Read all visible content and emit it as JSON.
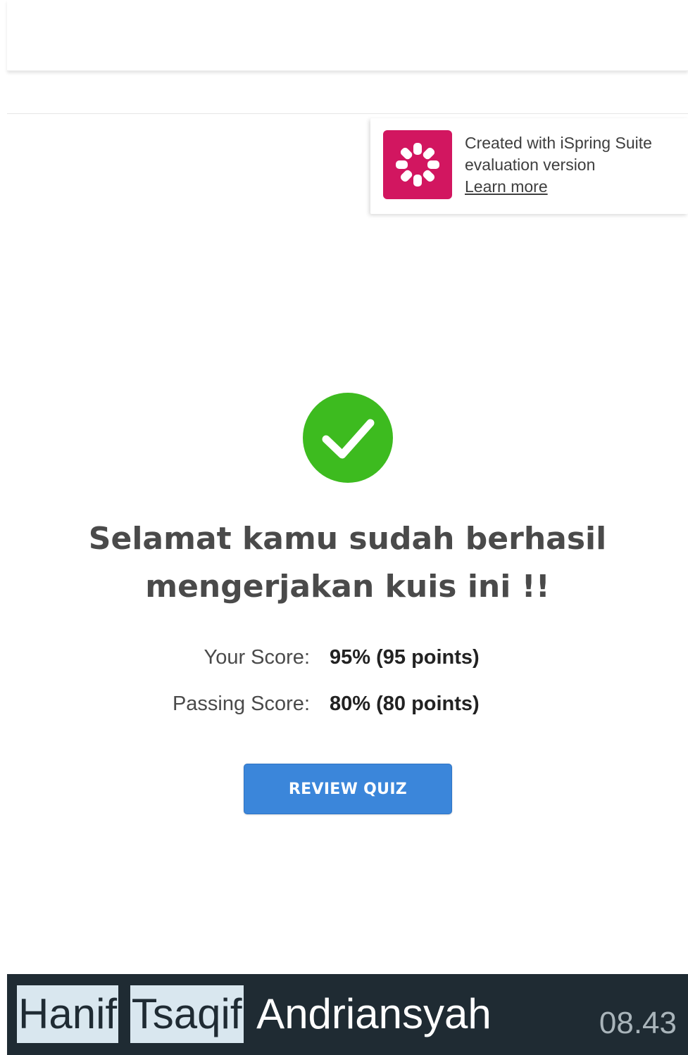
{
  "ispring_banner": {
    "line1": "Created with iSpring Suite",
    "line2": "evaluation version",
    "link": "Learn more",
    "logo_icon": "ispring-logo-icon",
    "logo_color": "#d21660"
  },
  "result": {
    "status_icon": "checkmark-icon",
    "status_color": "#3dbb1f",
    "headline_line1": "Selamat kamu sudah berhasil",
    "headline_line2": "mengerjakan kuis ini !!",
    "your_score_label": "Your Score:",
    "your_score_value": "95% (95 points)",
    "passing_score_label": "Passing Score:",
    "passing_score_value": "80% (80 points)",
    "review_button": "REVIEW QUIZ",
    "button_color": "#3b86da"
  },
  "footer": {
    "name_parts": [
      "Hanif",
      "Tsaqif",
      "Andriansyah"
    ],
    "time": "08.43"
  }
}
